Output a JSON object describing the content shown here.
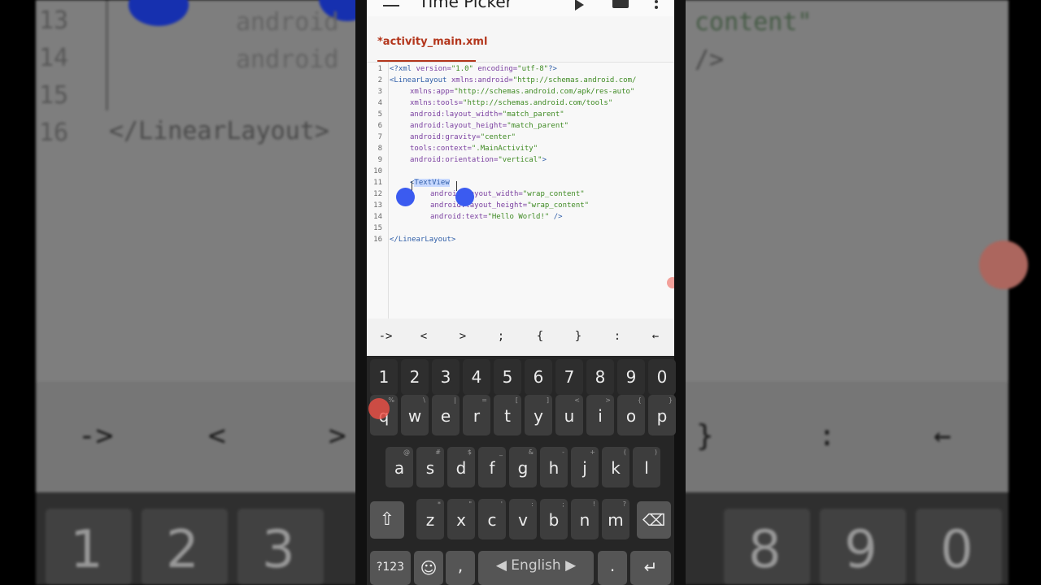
{
  "app": {
    "title": "Time Picker",
    "tab_label": "*activity_main.xml"
  },
  "icons": {
    "menu": "hamburger-icon",
    "run": "play-icon",
    "save": "save-icon",
    "more": "more-vert-icon"
  },
  "editor": {
    "line_numbers": [
      "1",
      "2",
      "3",
      "4",
      "5",
      "6",
      "7",
      "8",
      "9",
      "10",
      "11",
      "12",
      "13",
      "14",
      "15",
      "16"
    ],
    "lines": [
      {
        "indent": 0,
        "segments": [
          {
            "t": "<?xml ",
            "c": "t-tag"
          },
          {
            "t": "version=",
            "c": "t-attr"
          },
          {
            "t": "\"1.0\"",
            "c": "t-val"
          },
          {
            "t": " encoding=",
            "c": "t-attr"
          },
          {
            "t": "\"utf-8\"",
            "c": "t-val"
          },
          {
            "t": "?>",
            "c": "t-tag"
          }
        ]
      },
      {
        "indent": 0,
        "segments": [
          {
            "t": "<LinearLayout ",
            "c": "t-tag"
          },
          {
            "t": "xmlns:android=",
            "c": "t-attr"
          },
          {
            "t": "\"http://schemas.android.com/",
            "c": "t-val"
          }
        ]
      },
      {
        "indent": 1,
        "segments": [
          {
            "t": "xmlns:app=",
            "c": "t-attr"
          },
          {
            "t": "\"http://schemas.android.com/apk/res-auto\"",
            "c": "t-val"
          }
        ]
      },
      {
        "indent": 1,
        "segments": [
          {
            "t": "xmlns:tools=",
            "c": "t-attr"
          },
          {
            "t": "\"http://schemas.android.com/tools\"",
            "c": "t-val"
          }
        ]
      },
      {
        "indent": 1,
        "segments": [
          {
            "t": "android:layout_width=",
            "c": "t-attr"
          },
          {
            "t": "\"match_parent\"",
            "c": "t-val"
          }
        ]
      },
      {
        "indent": 1,
        "segments": [
          {
            "t": "android:layout_height=",
            "c": "t-attr"
          },
          {
            "t": "\"match_parent\"",
            "c": "t-val"
          }
        ]
      },
      {
        "indent": 1,
        "segments": [
          {
            "t": "android:gravity=",
            "c": "t-attr"
          },
          {
            "t": "\"center\"",
            "c": "t-val"
          }
        ]
      },
      {
        "indent": 1,
        "segments": [
          {
            "t": "tools:context=",
            "c": "t-attr"
          },
          {
            "t": "\".MainActivity\"",
            "c": "t-val"
          }
        ]
      },
      {
        "indent": 1,
        "segments": [
          {
            "t": "android:orientation=",
            "c": "t-attr"
          },
          {
            "t": "\"vertical\"",
            "c": "t-val"
          },
          {
            "t": ">",
            "c": "t-tag"
          }
        ]
      },
      {
        "indent": 0,
        "segments": []
      },
      {
        "indent": 1,
        "segments": [
          {
            "t": "<",
            "c": "t-tag"
          },
          {
            "t": "TextView",
            "c": "t-sel"
          }
        ]
      },
      {
        "indent": 2,
        "segments": [
          {
            "t": "android:layout_width=",
            "c": "t-attr"
          },
          {
            "t": "\"wrap_content\"",
            "c": "t-val"
          }
        ]
      },
      {
        "indent": 2,
        "segments": [
          {
            "t": "android:layout_height=",
            "c": "t-attr"
          },
          {
            "t": "\"wrap_content\"",
            "c": "t-val"
          }
        ]
      },
      {
        "indent": 2,
        "segments": [
          {
            "t": "android:text=",
            "c": "t-attr"
          },
          {
            "t": "\"Hello World!\"",
            "c": "t-val"
          },
          {
            "t": " />",
            "c": "t-tag"
          }
        ]
      },
      {
        "indent": 0,
        "segments": []
      },
      {
        "indent": 0,
        "segments": [
          {
            "t": "</LinearLayout>",
            "c": "t-tag"
          }
        ]
      }
    ]
  },
  "symbol_bar": [
    "->",
    "<",
    ">",
    ";",
    "{",
    "}",
    ":",
    "←"
  ],
  "keyboard": {
    "row_numbers": [
      "1",
      "2",
      "3",
      "4",
      "5",
      "6",
      "7",
      "8",
      "9",
      "0"
    ],
    "row1": [
      {
        "k": "q",
        "h": "%"
      },
      {
        "k": "w",
        "h": "\\"
      },
      {
        "k": "e",
        "h": "|"
      },
      {
        "k": "r",
        "h": "="
      },
      {
        "k": "t",
        "h": "["
      },
      {
        "k": "y",
        "h": "]"
      },
      {
        "k": "u",
        "h": "<"
      },
      {
        "k": "i",
        "h": ">"
      },
      {
        "k": "o",
        "h": "{"
      },
      {
        "k": "p",
        "h": "}"
      }
    ],
    "row2": [
      {
        "k": "a",
        "h": "@"
      },
      {
        "k": "s",
        "h": "#"
      },
      {
        "k": "d",
        "h": "$"
      },
      {
        "k": "f",
        "h": "_"
      },
      {
        "k": "g",
        "h": "&"
      },
      {
        "k": "h",
        "h": "-"
      },
      {
        "k": "j",
        "h": "+"
      },
      {
        "k": "k",
        "h": "("
      },
      {
        "k": "l",
        "h": ")"
      }
    ],
    "row3": [
      {
        "k": "z",
        "h": "*"
      },
      {
        "k": "x",
        "h": "\""
      },
      {
        "k": "c",
        "h": "'"
      },
      {
        "k": "v",
        "h": ":"
      },
      {
        "k": "b",
        "h": ";"
      },
      {
        "k": "n",
        "h": "!"
      },
      {
        "k": "m",
        "h": "?"
      }
    ],
    "shift": "⇧",
    "backspace": "⌫",
    "symbols": "?123",
    "emoji": "☺",
    "comma": ",",
    "space": "◀ English ▶",
    "period": ".",
    "enter": "↵"
  },
  "background": {
    "line_numbers": [
      "13",
      "14",
      "15",
      "16"
    ],
    "fragments": [
      "android",
      "android",
      "</LinearLayout>",
      "content\"",
      "/>"
    ],
    "symbols": [
      "->",
      "<",
      ">",
      "}",
      ":",
      "←"
    ],
    "number_keys": [
      "1",
      "2",
      "3",
      "8",
      "9",
      "0"
    ]
  }
}
